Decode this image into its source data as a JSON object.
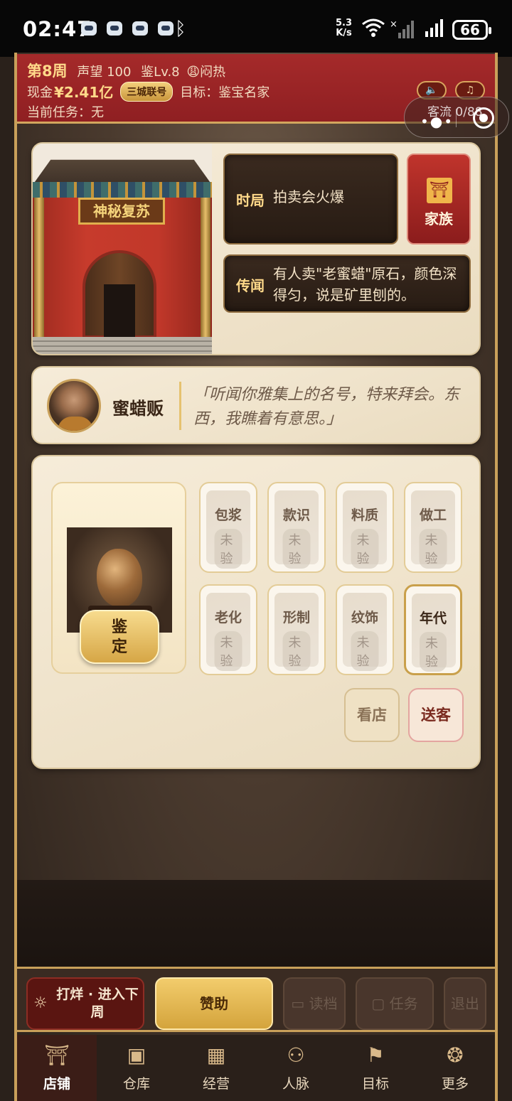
{
  "status_bar": {
    "time": "02:47",
    "net_speed_value": "5.3",
    "net_speed_unit": "K/s",
    "battery": "66"
  },
  "header": {
    "week": "第8周",
    "reputation": "声望 100",
    "appraise_level": "鉴Lv.8",
    "weather": "闷热",
    "cash_label": "现金",
    "cash_value": "¥2.41亿",
    "badge": "三城联号",
    "goal": "目标：鉴宝名家",
    "task": "当前任务：无"
  },
  "capsule": {
    "traffic": "客流 0/88"
  },
  "scene": {
    "plaque": "神秘复苏",
    "situation_label": "时局",
    "situation_text": "拍卖会火爆",
    "rumor_label": "传闻",
    "rumor_text": "有人卖\"老蜜蜡\"原石，颜色深得匀，说是矿里刨的。",
    "family_label": "家族"
  },
  "npc": {
    "name": "蜜蜡贩",
    "quote": "「听闻你雅集上的名号，特来拜会。东西，我瞧着有意思。」"
  },
  "appraisal": {
    "appraise_button": "鉴定",
    "traits": [
      {
        "name": "包浆",
        "status": "未验"
      },
      {
        "name": "款识",
        "status": "未验"
      },
      {
        "name": "料质",
        "status": "未验"
      },
      {
        "name": "做工",
        "status": "未验"
      },
      {
        "name": "老化",
        "status": "未验"
      },
      {
        "name": "形制",
        "status": "未验"
      },
      {
        "name": "纹饰",
        "status": "未验"
      },
      {
        "name": "年代",
        "status": "未验"
      }
    ],
    "view_shop": "看店",
    "see_off": "送客"
  },
  "actions": {
    "next_week": "打烊 · 进入下周",
    "sponsor": "赞助",
    "load": "读档",
    "tasks": "任务",
    "exit": "退出"
  },
  "tabs": [
    {
      "label": "店铺",
      "icon": "shop-icon"
    },
    {
      "label": "仓库",
      "icon": "warehouse-icon"
    },
    {
      "label": "经营",
      "icon": "abacus-icon"
    },
    {
      "label": "人脉",
      "icon": "people-icon"
    },
    {
      "label": "目标",
      "icon": "target-icon"
    },
    {
      "label": "更多",
      "icon": "more-icon"
    }
  ]
}
